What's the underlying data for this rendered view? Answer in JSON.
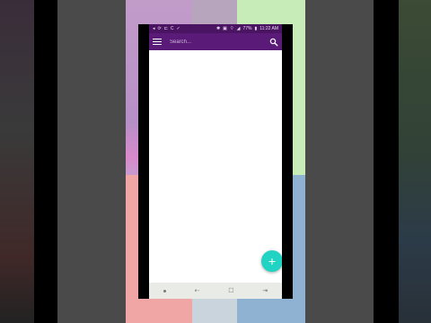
{
  "status_bar": {
    "left_icons": [
      "notification-icon",
      "sync-icon",
      "cast-icon",
      "c-icon",
      "check-icon"
    ],
    "left_glyphs": [
      "◂",
      "⟳",
      "⊏",
      "C",
      "✓"
    ],
    "right_glyphs": [
      "✱",
      "▣",
      "⌔",
      "◢"
    ],
    "battery_text": "77%",
    "battery_glyph": "▮",
    "time": "11:22 AM"
  },
  "app_bar": {
    "search_placeholder": "Search..."
  },
  "fab": {
    "label": "+"
  },
  "nav_bar": {
    "back": "⇠",
    "home": "☐",
    "recents": "⇥"
  },
  "colors": {
    "status_bar": "#4a1463",
    "app_bar": "#5a1a78",
    "fab": "#20d3c2"
  }
}
